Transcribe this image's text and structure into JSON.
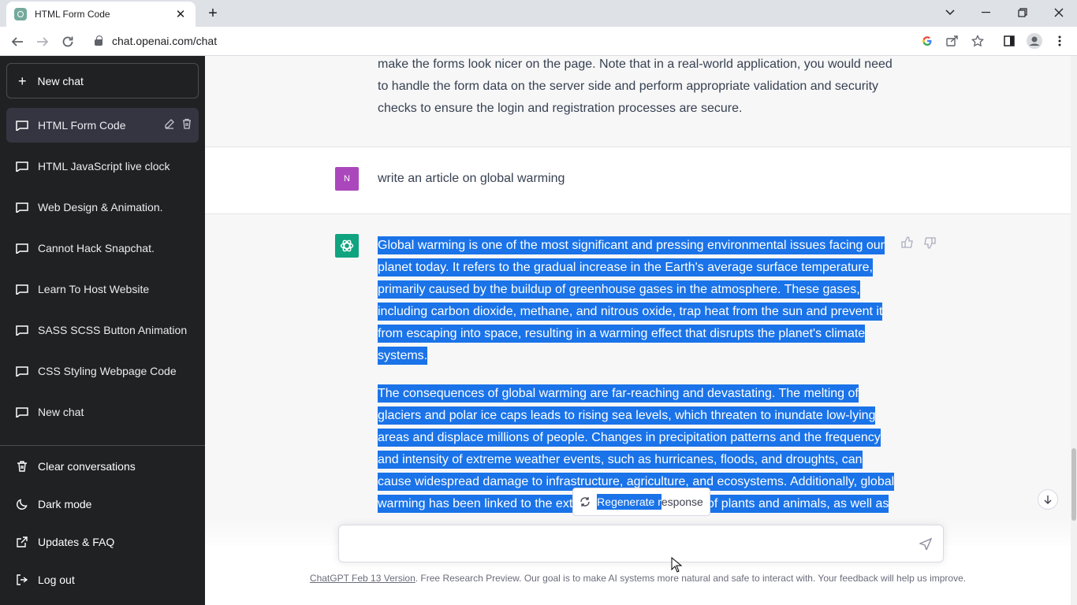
{
  "browser": {
    "tab_title": "HTML Form Code",
    "url": "chat.openai.com/chat",
    "tab_close": "✕",
    "new_tab": "+"
  },
  "sidebar": {
    "new_chat": "New chat",
    "conversations": [
      "HTML Form Code",
      "HTML JavaScript live clock",
      "Web Design & Animation.",
      "Cannot Hack Snapchat.",
      "Learn To Host Website",
      "SASS SCSS Button Animation",
      "CSS Styling Webpage Code",
      "New chat"
    ],
    "bottom": {
      "clear": "Clear conversations",
      "dark": "Dark mode",
      "updates": "Updates & FAQ",
      "logout": "Log out"
    }
  },
  "chat": {
    "prev_answer_tail": "make the forms look nicer on the page. Note that in a real-world application, you would need to handle the form data on the server side and perform appropriate validation and security checks to ensure the login and registration processes are secure.",
    "user_avatar": "N",
    "user_prompt": "write an article on global warming",
    "answer_p1": "Global warming is one of the most significant and pressing environmental issues facing our planet today. It refers to the gradual increase in the Earth's average surface temperature, primarily caused by the buildup of greenhouse gases in the atmosphere. These gases, including carbon dioxide, methane, and nitrous oxide, trap heat from the sun and prevent it from escaping into space, resulting in a warming effect that disrupts the planet's climate systems.",
    "answer_p2": "The consequences of global warming are far-reaching and devastating. The melting of glaciers and polar ice caps leads to rising sea levels, which threaten to inundate low-lying areas and displace millions of people. Changes in precipitation patterns and the frequency and intensity of extreme weather events, such as hurricanes, floods, and droughts, can cause widespread damage to infrastructure, agriculture, and ecosystems. Additionally, global warming has been linked to the extinction of many species of plants and animals, as well as",
    "regen_selected": "Regenerate r",
    "regen_rest": "esponse",
    "input_placeholder": ""
  },
  "footer": {
    "link": "ChatGPT Feb 13 Version",
    "text": ". Free Research Preview. Our goal is to make AI systems more natural and safe to interact with. Your feedback will help us improve."
  },
  "colors": {
    "sidebar_bg": "#202123",
    "selection": "#1a73e8",
    "gpt_green": "#10a37f",
    "user_avatar": "#ab47bc"
  }
}
